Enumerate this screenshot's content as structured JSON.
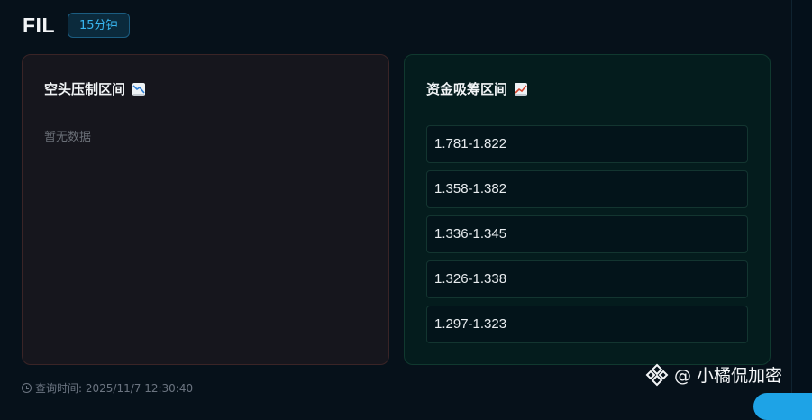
{
  "header": {
    "symbol": "FIL",
    "timeframe": "15分钟"
  },
  "short_panel": {
    "title": "空头压制区间",
    "icon": "chart-decreasing-icon",
    "empty_text": "暂无数据"
  },
  "long_panel": {
    "title": "资金吸筹区间",
    "icon": "chart-increasing-icon",
    "zones": [
      "1.781-1.822",
      "1.358-1.382",
      "1.336-1.345",
      "1.326-1.338",
      "1.297-1.323"
    ]
  },
  "footer": {
    "query_time": "查询时间: 2025/11/7 12:30:40"
  },
  "watermark": {
    "text": "@ 小橘侃加密",
    "logo": "binance-logo-icon"
  },
  "colors": {
    "background": "#06111a",
    "short_panel_bg": "#16161d",
    "long_panel_bg": "#041c1d",
    "badge_text": "#38b6f0"
  }
}
